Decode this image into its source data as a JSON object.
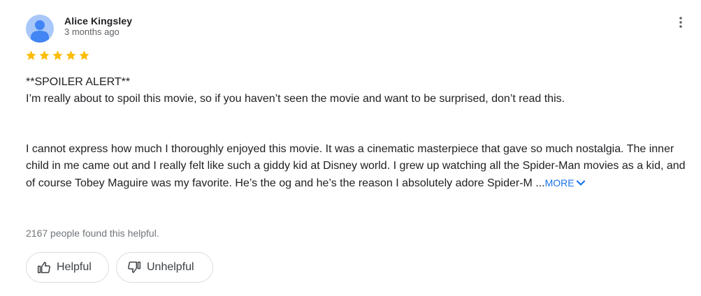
{
  "review": {
    "author_name": "Alice Kingsley",
    "date": "3 months ago",
    "rating": 5,
    "max_rating": 5,
    "star_color": "#fbbc04",
    "paragraphs": [
      "**SPOILER ALERT**",
      "I’m really about to spoil this movie, so if you haven’t seen the movie and want to be surprised, don’t read this.",
      "I cannot express how much I thoroughly enjoyed this movie. It was a cinematic masterpiece that gave so much nostalgia. The inner child in me came out and I really felt like such a giddy kid at Disney world. I grew up watching all the Spider-Man movies as a kid, and of course Tobey Maguire was my favorite. He’s the og and he’s the reason I absolutely adore Spider-M ..."
    ],
    "more_label": "MORE",
    "helpful_count_text": "2167 people found this helpful.",
    "helpful_label": "Helpful",
    "unhelpful_label": "Unhelpful"
  },
  "icons": {
    "avatar": "person-avatar-icon",
    "menu": "more-vert-icon",
    "star": "star-icon",
    "more": "chevron-down-icon",
    "helpful": "thumb-up-icon",
    "unhelpful": "thumb-down-icon"
  },
  "colors": {
    "avatar_bg": "#a8c7fa",
    "avatar_fg": "#4285f4",
    "link": "#1a73e8"
  }
}
